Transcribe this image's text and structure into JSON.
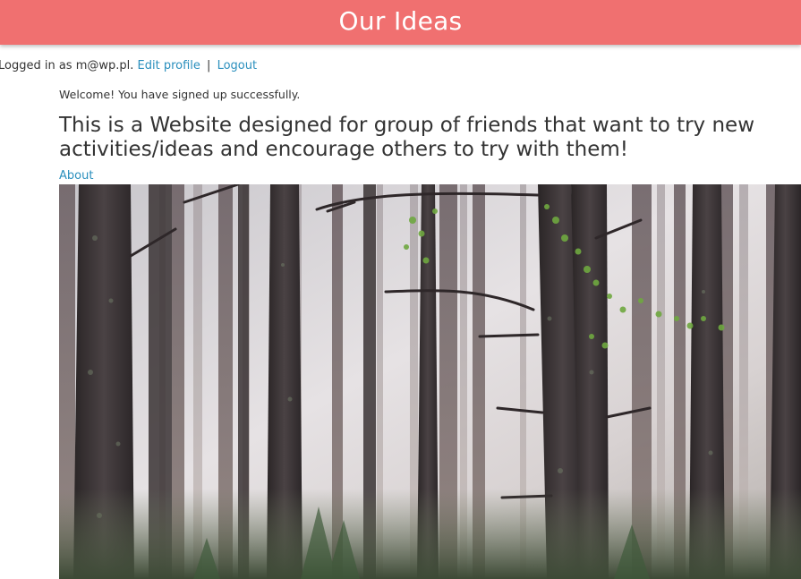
{
  "header": {
    "title": "Our Ideas"
  },
  "session": {
    "logged_in_text": "Logged in as m@wp.pl.",
    "edit_profile_label": "Edit profile",
    "separator": "|",
    "logout_label": "Logout"
  },
  "flash": {
    "message": "Welcome! You have signed up successfully."
  },
  "main": {
    "headline": "This is a Website designed for group of friends that want to try new activities/ideas and encourage others to try with them!",
    "about_label": "About"
  },
  "colors": {
    "header_bg": "#f07070",
    "link": "#2a8fbd",
    "text": "#333333"
  }
}
